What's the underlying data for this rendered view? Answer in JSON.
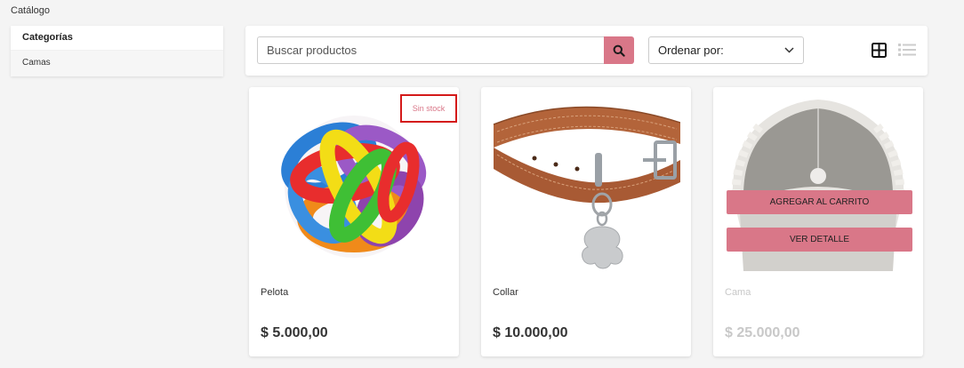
{
  "page": {
    "title": "Catálogo"
  },
  "sidebar": {
    "title": "Categorías",
    "items": [
      {
        "label": "Camas"
      }
    ]
  },
  "toolbar": {
    "search_placeholder": "Buscar productos",
    "search_icon": "search-icon",
    "sort_label": "Ordenar por:",
    "grid_view_icon": "grid-view-icon",
    "list_view_icon": "list-view-icon"
  },
  "products": [
    {
      "name": "Pelota",
      "price": "$ 5.000,00",
      "badge": "Sin stock",
      "image": "ball-toy-image"
    },
    {
      "name": "Collar",
      "price": "$ 10.000,00",
      "image": "collar-image"
    },
    {
      "name": "Cama",
      "price": "$ 25.000,00",
      "image": "pet-bed-image",
      "actions": {
        "add_to_cart": "AGREGAR AL CARRITO",
        "details": "VER DETALLE"
      }
    }
  ],
  "colors": {
    "accent": "#d97788",
    "highlight_border": "#d41a1a",
    "background": "#f4f4f4"
  }
}
